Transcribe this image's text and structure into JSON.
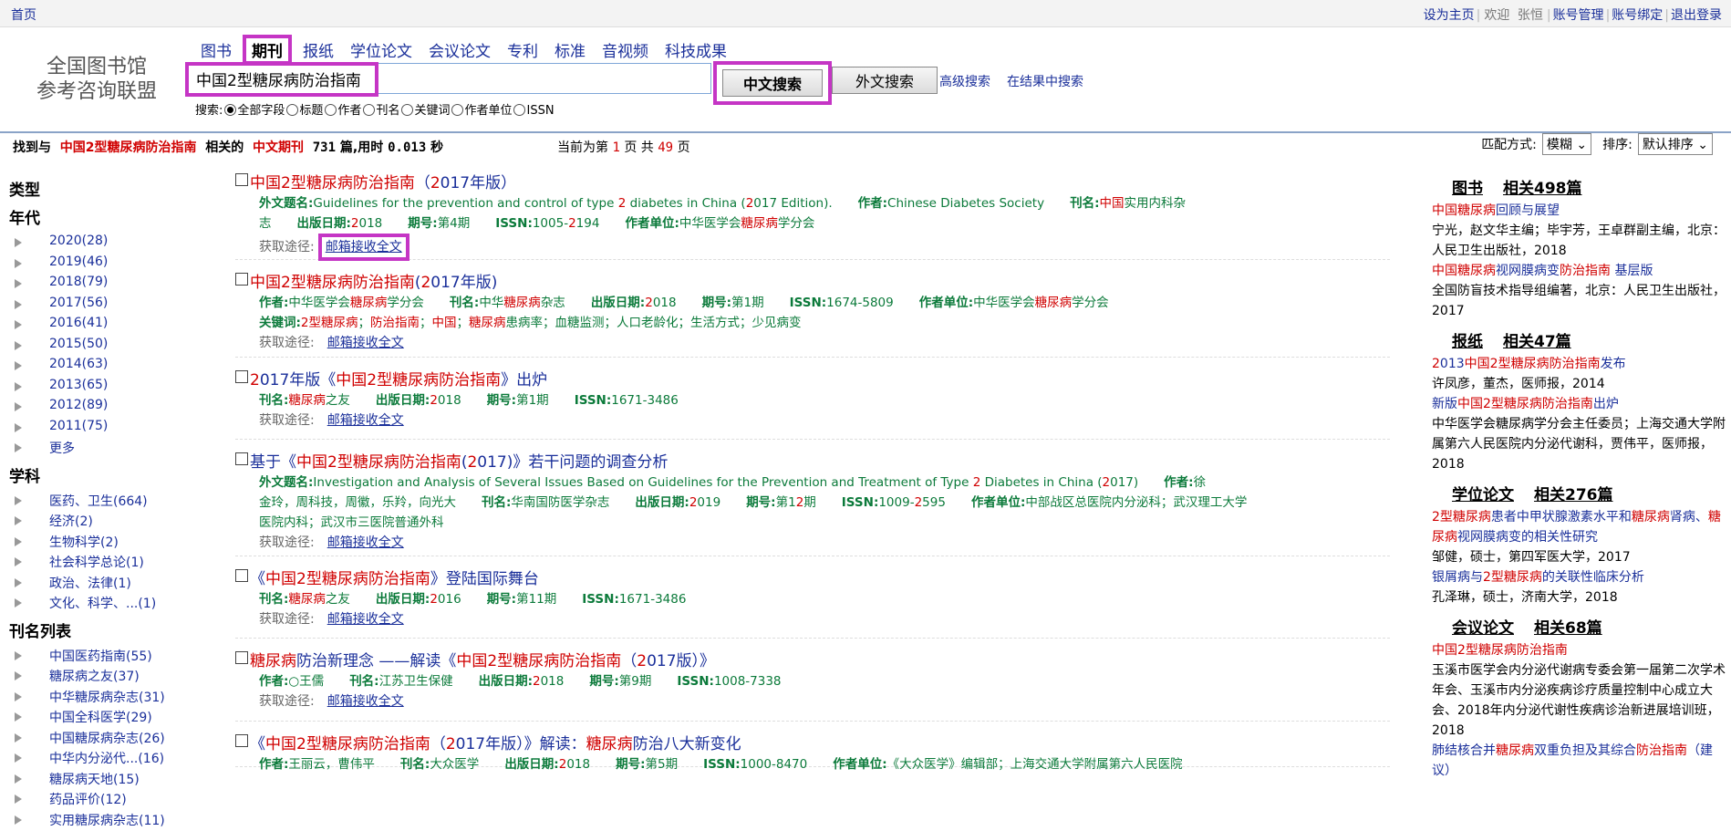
{
  "topbar": {
    "home": "首页",
    "set_home": "设为主页",
    "welcome": "欢迎",
    "user": "张恒",
    "account": "账号管理",
    "bind": "账号绑定",
    "logout": "退出登录"
  },
  "logo": {
    "line1": "全国图书馆",
    "line2": "参考咨询联盟"
  },
  "tabs": [
    "图书",
    "期刊",
    "报纸",
    "学位论文",
    "会议论文",
    "专利",
    "标准",
    "音视频",
    "科技成果"
  ],
  "active_tab": "期刊",
  "search": {
    "query": "中国2型糖尿病防治指南",
    "cn_button": "中文搜索",
    "foreign_button": "外文搜索",
    "advanced": "高级搜索",
    "in_results": "在结果中搜索",
    "fields_label": "搜索:",
    "fields": [
      "全部字段",
      "标题",
      "作者",
      "刊名",
      "关键词",
      "作者单位",
      "ISSN"
    ],
    "selected_field": "全部字段"
  },
  "results_bar": {
    "prefix": "找到与",
    "query": "中国2型糖尿病防治指南",
    "mid": "相关的",
    "type": "中文期刊",
    "count": "731",
    "suffix": "篇,用时",
    "time": "0.013",
    "sec": "秒",
    "page_prefix": "当前为第",
    "current_page": "1",
    "page_mid": "页  共",
    "total_pages": "49",
    "page_suffix": "页",
    "match_label": "匹配方式:",
    "match_value": "模糊",
    "sort_label": "排序:",
    "sort_value": "默认排序"
  },
  "facets": {
    "type_header": "类型",
    "year_header": "年代",
    "years": [
      "2020(28)",
      "2019(46)",
      "2018(79)",
      "2017(56)",
      "2016(41)",
      "2015(50)",
      "2014(63)",
      "2013(65)",
      "2012(89)",
      "2011(75)",
      "更多"
    ],
    "subject_header": "学科",
    "subjects": [
      "医药、卫生(664)",
      "经济(2)",
      "生物科学(2)",
      "社会科学总论(1)",
      "政治、法律(1)",
      "文化、科学、...(1)"
    ],
    "journal_header": "刊名列表",
    "journals": [
      "中国医药指南(55)",
      "糖尿病之友(37)",
      "中华糖尿病杂志(31)",
      "中国全科医学(29)",
      "中国糖尿病杂志(26)",
      "中华内分泌代...(16)",
      "糖尿病天地(15)",
      "药品评价(12)",
      "实用糖尿病杂志(11)"
    ]
  },
  "get_label": "获取途径:",
  "get_link": "邮箱接收全文",
  "results": [
    {
      "title": "中国2型糖尿病防治指南（2017年版）",
      "lines": [
        [
          [
            "外文题名:",
            "Guidelines for the prevention and control of type 2 diabetes in China (2017 Edition)."
          ],
          [
            "作者:",
            "Chinese Diabetes Society"
          ],
          [
            "刊名:",
            "中国实用内科杂"
          ]
        ],
        [
          [
            "",
            "志"
          ],
          [
            "出版日期:",
            "2018"
          ],
          [
            "期号:",
            "第4期"
          ],
          [
            "ISSN:",
            "1005-2194"
          ],
          [
            "作者单位:",
            "中华医学会糖尿病学分会"
          ]
        ]
      ]
    },
    {
      "title": "中国2型糖尿病防治指南(2017年版)",
      "lines": [
        [
          [
            "作者:",
            "中华医学会糖尿病学分会"
          ],
          [
            "刊名:",
            "中华糖尿病杂志"
          ],
          [
            "出版日期:",
            "2018"
          ],
          [
            "期号:",
            "第1期"
          ],
          [
            "ISSN:",
            "1674-5809"
          ],
          [
            "作者单位:",
            "中华医学会糖尿病学分会"
          ]
        ],
        [
          [
            "关键词:",
            "2型糖尿病；防治指南；中国；糖尿病患病率；血糖监测；人口老龄化；生活方式；少见病变"
          ]
        ]
      ]
    },
    {
      "title": "2017年版《中国2型糖尿病防治指南》出炉",
      "lines": [
        [
          [
            "刊名:",
            "糖尿病之友"
          ],
          [
            "出版日期:",
            "2018"
          ],
          [
            "期号:",
            "第1期"
          ],
          [
            "ISSN:",
            "1671-3486"
          ]
        ]
      ]
    },
    {
      "title": "基于《中国2型糖尿病防治指南(2017)》若干问题的调查分析",
      "lines": [
        [
          [
            "外文题名:",
            "Investigation and Analysis of Several Issues Based on Guidelines for the Prevention and Treatment of Type 2 Diabetes in China (2017)"
          ],
          [
            "作者:",
            "徐"
          ]
        ],
        [
          [
            "",
            "金玲，周科技，周徽，乐羚，向光大"
          ],
          [
            "刊名:",
            "华南国防医学杂志"
          ],
          [
            "出版日期:",
            "2019"
          ],
          [
            "期号:",
            "第12期"
          ],
          [
            "ISSN:",
            "1009-2595"
          ],
          [
            "作者单位:",
            "中部战区总医院内分泌科；武汉理工大学"
          ]
        ],
        [
          [
            "",
            "医院内科；武汉市三医院普通外科"
          ]
        ]
      ]
    },
    {
      "title": "《中国2型糖尿病防治指南》登陆国际舞台",
      "lines": [
        [
          [
            "刊名:",
            "糖尿病之友"
          ],
          [
            "出版日期:",
            "2016"
          ],
          [
            "期号:",
            "第11期"
          ],
          [
            "ISSN:",
            "1671-3486"
          ]
        ]
      ]
    },
    {
      "title": "糖尿病防治新理念 ——解读《中国2型糖尿病防治指南（2017版）》",
      "lines": [
        [
          [
            "作者:",
            "○王儒"
          ],
          [
            "刊名:",
            "江苏卫生保健"
          ],
          [
            "出版日期:",
            "2018"
          ],
          [
            "期号:",
            "第9期"
          ],
          [
            "ISSN:",
            "1008-7338"
          ]
        ]
      ]
    },
    {
      "title": "《中国2型糖尿病防治指南（2017年版）》解读：糖尿病防治八大新变化",
      "lines": [
        [
          [
            "作者:",
            "王丽云，曹伟平"
          ],
          [
            "刊名:",
            "大众医学"
          ],
          [
            "出版日期:",
            "2018"
          ],
          [
            "期号:",
            "第5期"
          ],
          [
            "ISSN:",
            "1000-8470"
          ],
          [
            "作者单位:",
            "《大众医学》编辑部；上海交通大学附属第六人民医院"
          ]
        ]
      ]
    }
  ],
  "right": {
    "books": {
      "cat": "图书",
      "count": "相关498篇",
      "items": [
        {
          "title": "中国糖尿病回顾与展望",
          "info": "宁光，赵文华主编；毕宇芳，王卓群副主编，北京：人民卫生出版社，2018"
        },
        {
          "title": "中国糖尿病视网膜病变防治指南 基层版",
          "info": "全国防盲技术指导组编著，北京：人民卫生出版社，2017"
        }
      ]
    },
    "newspapers": {
      "cat": "报纸",
      "count": "相关47篇",
      "items": [
        {
          "title": "2013中国2型糖尿病防治指南发布",
          "info": "许凤彦，董杰，医师报，2014"
        },
        {
          "title": "新版中国2型糖尿病防治指南出炉",
          "info": "中华医学会糖尿病学分会主任委员；上海交通大学附属第六人民医院内分泌代谢科，贾伟平，医师报，2018"
        }
      ]
    },
    "theses": {
      "cat": "学位论文",
      "count": "相关276篇",
      "items": [
        {
          "title": "2型糖尿病患者中甲状腺激素水平和糖尿病肾病、糖尿病视网膜病变的相关性研究",
          "info": "邹健，硕士，第四军医大学，2017"
        },
        {
          "title": "银屑病与2型糖尿病的关联性临床分析",
          "info": "孔泽琳，硕士，济南大学，2018"
        }
      ]
    },
    "conferences": {
      "cat": "会议论文",
      "count": "相关68篇",
      "items": [
        {
          "title": "中国2型糖尿病防治指南",
          "info": "玉溪市医学会内分泌代谢病专委会第一届第二次学术年会、玉溪市内分泌疾病诊疗质量控制中心成立大会、2018年内分泌代谢性疾病诊治新进展培训班，2018"
        },
        {
          "title": "肺结核合并糖尿病双重负担及其综合防治指南（建议）",
          "info": ""
        }
      ]
    }
  }
}
